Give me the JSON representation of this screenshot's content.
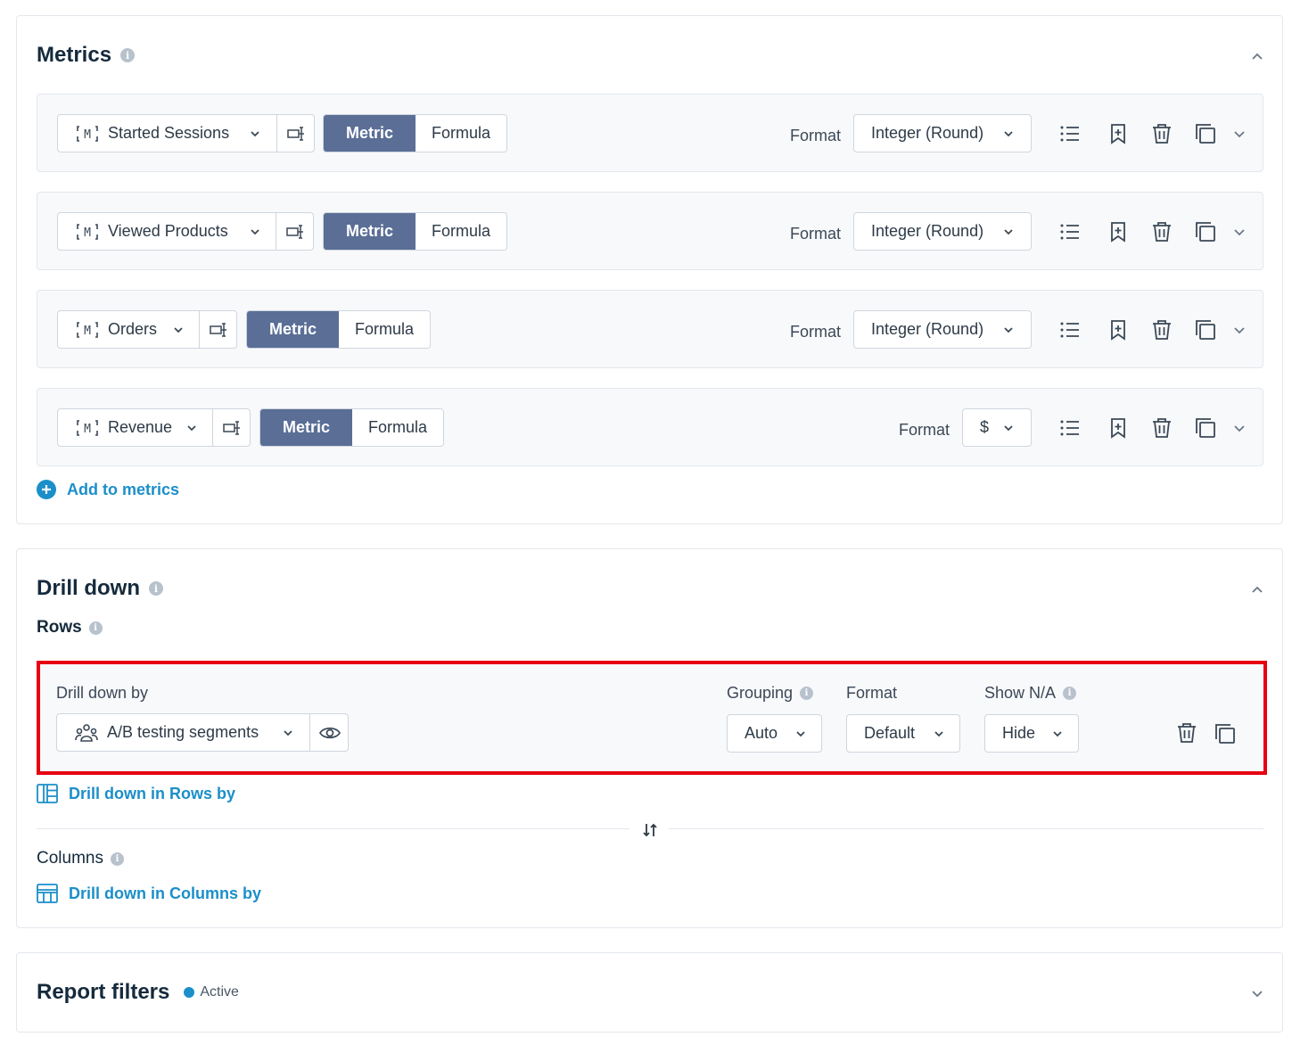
{
  "metrics": {
    "title": "Metrics",
    "rows": [
      {
        "name": "Started Sessions",
        "seg_on": "Metric",
        "seg_off": "Formula",
        "format_label": "Format",
        "format_value": "Integer (Round)"
      },
      {
        "name": "Viewed Products",
        "seg_on": "Metric",
        "seg_off": "Formula",
        "format_label": "Format",
        "format_value": "Integer (Round)"
      },
      {
        "name": "Orders",
        "seg_on": "Metric",
        "seg_off": "Formula",
        "format_label": "Format",
        "format_value": "Integer (Round)"
      },
      {
        "name": "Revenue",
        "seg_on": "Metric",
        "seg_off": "Formula",
        "format_label": "Format",
        "format_value": "$"
      }
    ],
    "add_label": "Add to metrics"
  },
  "drilldown": {
    "title": "Drill down",
    "rows_title": "Rows",
    "by_label": "Drill down by",
    "by_value": "A/B testing segments",
    "grouping_label": "Grouping",
    "grouping_value": "Auto",
    "format_label": "Format",
    "format_value": "Default",
    "showna_label": "Show N/A",
    "showna_value": "Hide",
    "rows_link": "Drill down in Rows by",
    "columns_title": "Columns",
    "columns_link": "Drill down in Columns by"
  },
  "filters": {
    "title": "Report filters",
    "status": "Active"
  },
  "colors": {
    "accent": "#1b8fc9",
    "segment_active": "#5a6e96",
    "highlight": "#e60012"
  }
}
